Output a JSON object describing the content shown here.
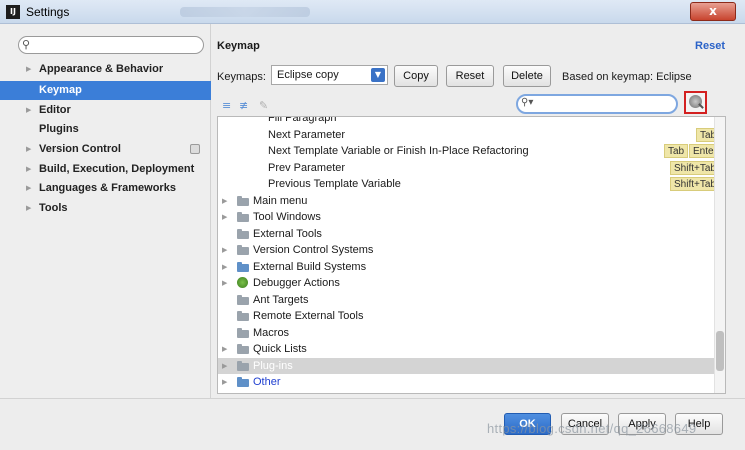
{
  "window": {
    "title": "Settings",
    "close_label": "x"
  },
  "sidebar": {
    "search_placeholder": "",
    "items": [
      {
        "label": "Appearance & Behavior",
        "expandable": true
      },
      {
        "label": "Keymap",
        "expandable": false,
        "selected": true
      },
      {
        "label": "Editor",
        "expandable": true
      },
      {
        "label": "Plugins",
        "expandable": false
      },
      {
        "label": "Version Control",
        "expandable": true
      },
      {
        "label": "Build, Execution, Deployment",
        "expandable": true
      },
      {
        "label": "Languages & Frameworks",
        "expandable": true
      },
      {
        "label": "Tools",
        "expandable": true
      }
    ]
  },
  "main": {
    "header": "Keymap",
    "reset_link": "Reset",
    "keymaps_label": "Keymaps:",
    "keymap_selected": "Eclipse copy",
    "copy_button": "Copy",
    "reset_button": "Reset",
    "delete_button": "Delete",
    "based_on": "Based on keymap: Eclipse",
    "search_value": ""
  },
  "tree": {
    "actions": [
      {
        "label": "Fill Paragraph",
        "shortcuts": []
      },
      {
        "label": "Next Parameter",
        "shortcuts": [
          "Tab"
        ]
      },
      {
        "label": "Next Template Variable or Finish In-Place Refactoring",
        "shortcuts": [
          "Tab",
          "Enter"
        ]
      },
      {
        "label": "Prev Parameter",
        "shortcuts": [
          "Shift+Tab"
        ]
      },
      {
        "label": "Previous Template Variable",
        "shortcuts": [
          "Shift+Tab"
        ]
      }
    ],
    "groups": [
      {
        "label": "Main menu",
        "expandable": true
      },
      {
        "label": "Tool Windows",
        "expandable": true
      },
      {
        "label": "External Tools",
        "expandable": false
      },
      {
        "label": "Version Control Systems",
        "expandable": true
      },
      {
        "label": "External Build Systems",
        "expandable": true
      },
      {
        "label": "Debugger Actions",
        "expandable": true
      },
      {
        "label": "Ant Targets",
        "expandable": false
      },
      {
        "label": "Remote External Tools",
        "expandable": false
      },
      {
        "label": "Macros",
        "expandable": false
      },
      {
        "label": "Quick Lists",
        "expandable": true
      },
      {
        "label": "Plug-ins",
        "expandable": true,
        "selected": true
      },
      {
        "label": "Other",
        "expandable": true
      }
    ]
  },
  "footer": {
    "ok": "OK",
    "cancel": "Cancel",
    "apply": "Apply",
    "help": "Help",
    "watermark": "https://blog.csdn.net/qq_26668649"
  },
  "colors": {
    "selection": "#3b7ed8",
    "shortcut_bg": "#efe6a8",
    "find_highlight": "#d32020"
  }
}
